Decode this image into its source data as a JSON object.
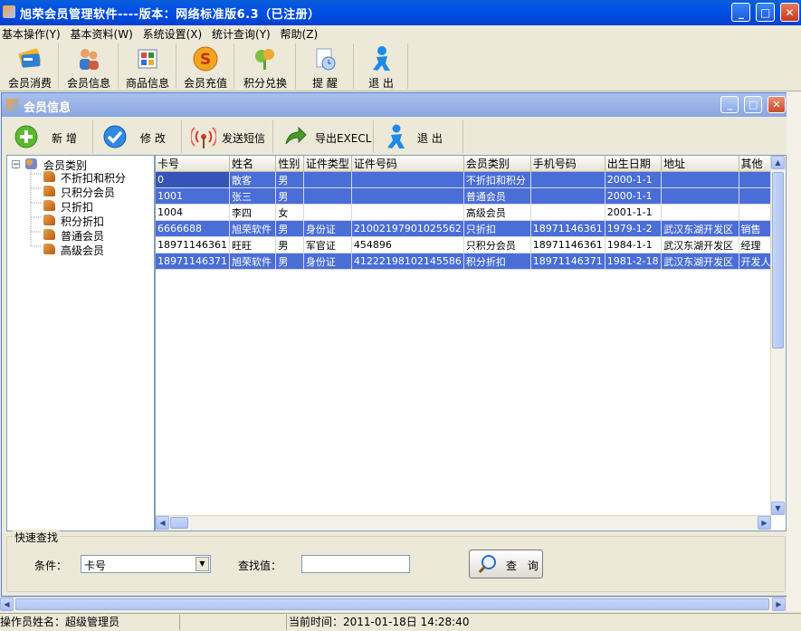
{
  "window": {
    "title": "旭荣会员管理软件----版本：网络标准版6.3（已注册）"
  },
  "menu": [
    "基本操作(Y)",
    "基本资料(W)",
    "系统设置(X)",
    "统计查询(Y)",
    "帮助(Z)"
  ],
  "toolbar": [
    "会员消费",
    "会员信息",
    "商品信息",
    "会员充值",
    "积分兑换",
    "提 醒",
    "退 出"
  ],
  "child": {
    "title": "会员信息",
    "toolbar": [
      "新 增",
      "修 改",
      "发送短信",
      "导出EXECL",
      "退 出"
    ]
  },
  "tree": {
    "root": "会员类别",
    "children": [
      "不折扣和积分",
      "只积分会员",
      "只折扣",
      "积分折扣",
      "普通会员",
      "高级会员"
    ]
  },
  "grid": {
    "columns": [
      "卡号",
      "姓名",
      "性别",
      "证件类型",
      "证件号码",
      "会员类别",
      "手机号码",
      "出生日期",
      "地址",
      "其他"
    ],
    "rows": [
      {
        "selected": true,
        "cells": [
          "0",
          "散客",
          "男",
          "",
          "",
          "不折扣和积分",
          "",
          "2000-1-1",
          "",
          ""
        ]
      },
      {
        "selected": true,
        "cells": [
          "1001",
          "张三",
          "男",
          "",
          "",
          "普通会员",
          "",
          "2000-1-1",
          "",
          ""
        ]
      },
      {
        "selected": false,
        "cells": [
          "1004",
          "李四",
          "女",
          "",
          "",
          "高级会员",
          "",
          "2001-1-1",
          "",
          ""
        ]
      },
      {
        "selected": true,
        "cells": [
          "6666688",
          "旭荣软件",
          "男",
          "身份证",
          "21002197901025562",
          "只折扣",
          "18971146361",
          "1979-1-2",
          "武汉东湖开发区",
          "销售"
        ]
      },
      {
        "selected": false,
        "cells": [
          "18971146361",
          "旺旺",
          "男",
          "军官证",
          "454896",
          "只积分会员",
          "18971146361",
          "1984-1-1",
          "武汉东湖开发区",
          "经理"
        ]
      },
      {
        "selected": true,
        "cells": [
          "18971146371",
          "旭荣软件",
          "男",
          "身份证",
          "41222198102145586",
          "积分折扣",
          "18971146371",
          "1981-2-18",
          "武汉东湖开发区",
          "开发人员"
        ]
      }
    ]
  },
  "search": {
    "legend": "快速查找",
    "condition_label": "条件：",
    "condition_value": "卡号",
    "value_label": "查找值：",
    "value": "",
    "button": "查 询"
  },
  "status": {
    "operator": "操作员姓名：超级管理员",
    "time": "当前时间：2011-01-18日 14:28:40"
  },
  "colors": {
    "titlebar": "#0050e6",
    "selection": "#4a6ed8",
    "face": "#ece9d8"
  }
}
